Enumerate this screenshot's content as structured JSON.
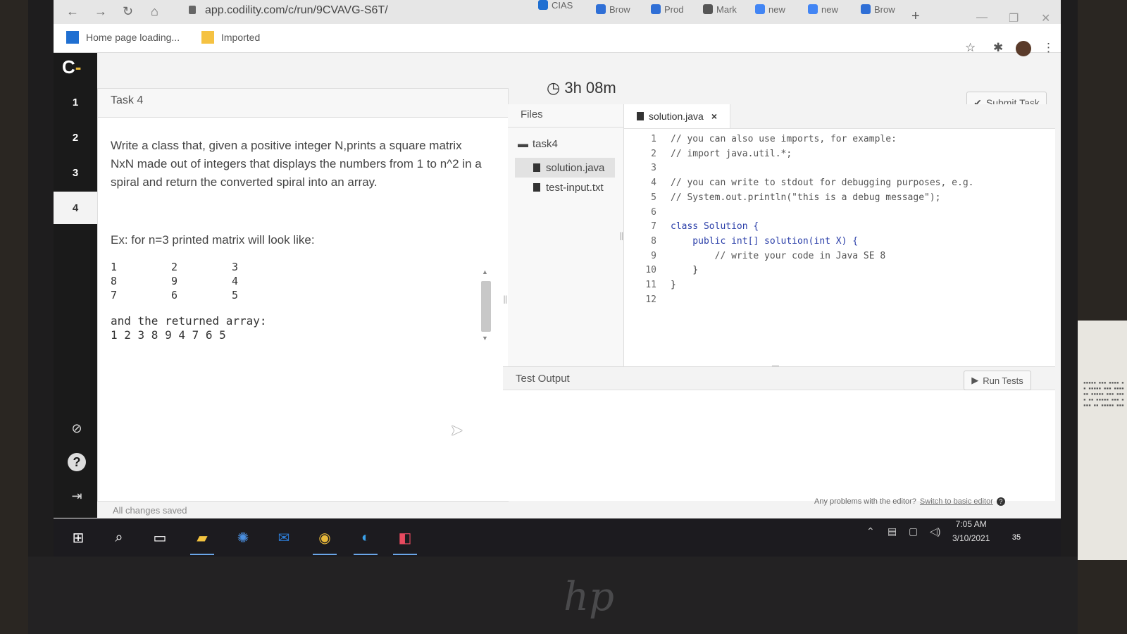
{
  "browser": {
    "url": "app.codility.com/c/run/9CVAVG-S6T/",
    "tabs": [
      {
        "label": "Brow",
        "color": "#2f6fd6"
      },
      {
        "label": "Prod",
        "color": "#2f6fd6"
      },
      {
        "label": "Mark",
        "color": "#555555"
      },
      {
        "label": "new",
        "color": "#4285f4"
      },
      {
        "label": "new",
        "color": "#4285f4"
      },
      {
        "label": "Brow",
        "color": "#2f6fd6"
      }
    ],
    "partial_tab": "CIAS",
    "new_tab_glyph": "+",
    "bookmarks": [
      {
        "label": "Home page loading...",
        "color": "#1f6fd1"
      },
      {
        "label": "Imported",
        "color": "#f5c242"
      }
    ]
  },
  "app": {
    "logo_letter": "C",
    "logo_accent": "-",
    "task_numbers": [
      "1",
      "2",
      "3",
      "4"
    ],
    "timer": "3h 08m",
    "submit_label": "Submit Task",
    "task": {
      "title": "Task 4",
      "description": "Write a class that, given a positive integer N,prints a square matrix NxN made out of integers that displays the numbers from 1 to n^2 in a spiral and return the converted spiral into an array.",
      "example_intro": "Ex: for n=3 printed matrix will look like:",
      "matrix": [
        [
          "1",
          "2",
          "3"
        ],
        [
          "8",
          "9",
          "4"
        ],
        [
          "7",
          "6",
          "5"
        ]
      ],
      "returned_label": "and the returned array:",
      "returned_array": "1 2 3 8 9 4 7 6 5"
    },
    "saved_status": "All changes saved",
    "files": {
      "header": "Files",
      "folder": "task4",
      "items": [
        "solution.java",
        "test-input.txt"
      ]
    },
    "editor": {
      "tab": "solution.java",
      "line_numbers": [
        "1",
        "2",
        "3",
        "4",
        "5",
        "6",
        "7",
        "8",
        "9",
        "10",
        "11",
        "12"
      ],
      "lines": [
        "// you can also use imports, for example:",
        "// import java.util.*;",
        "",
        "// you can write to stdout for debugging purposes, e.g.",
        "// System.out.println(\"this is a debug message\");",
        "",
        "class Solution {",
        "    public int[] solution(int X) {",
        "        // write your code in Java SE 8",
        "    }",
        "}",
        ""
      ]
    },
    "test_output": {
      "title": "Test Output",
      "run_label": "Run Tests"
    },
    "problems_text": "Any problems with the editor?",
    "problems_link": "Switch to basic editor"
  },
  "taskbar": {
    "time": "7:05 AM",
    "date": "3/10/2021",
    "notification_count": "35"
  },
  "monitor_brand": "hp"
}
